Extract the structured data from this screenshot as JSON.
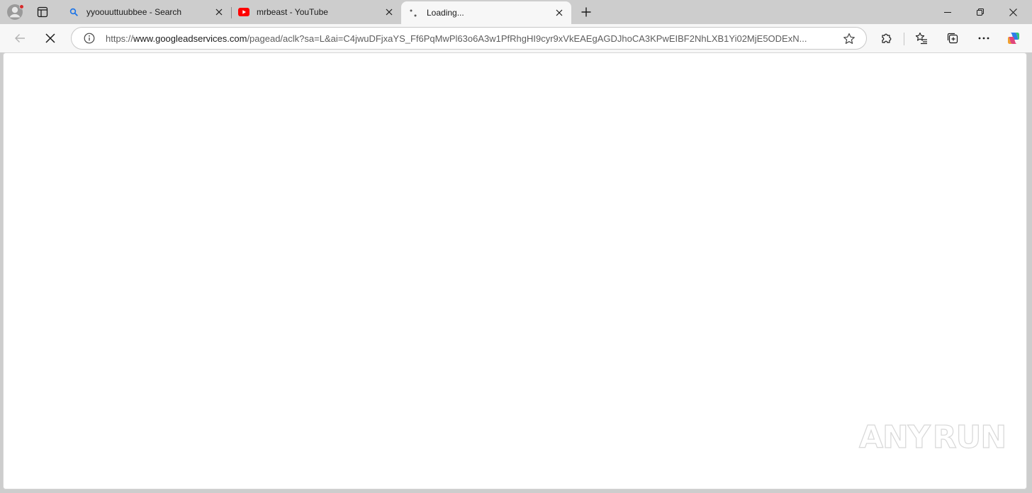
{
  "tabs": [
    {
      "title": "yyoouuttuubbee - Search",
      "favicon": "search-icon",
      "active": false
    },
    {
      "title": "mrbeast - YouTube",
      "favicon": "youtube-icon",
      "active": false
    },
    {
      "title": "Loading...",
      "favicon": "loading-spinner-icon",
      "active": true
    }
  ],
  "address_bar": {
    "scheme": "https://",
    "host": "www.googleadservices.com",
    "path": "/pagead/aclk?sa=L&ai=C4jwuDFjxaYS_Ff6PqMwPl63o6A3w1PfRhgHI9cyr9xVkEAEgAGDJhoCA3KPwEIBF2NhLXB1Yi02MjE5ODExN..."
  },
  "watermark": {
    "left": "ANY",
    "right": "RUN"
  },
  "colors": {
    "tabstrip_bg": "#cdcdcd",
    "toolbar_bg": "#f7f7f7",
    "youtube_red": "#ff0000",
    "search_blue": "#1a73e8",
    "profile_badge": "#d62b2b"
  }
}
